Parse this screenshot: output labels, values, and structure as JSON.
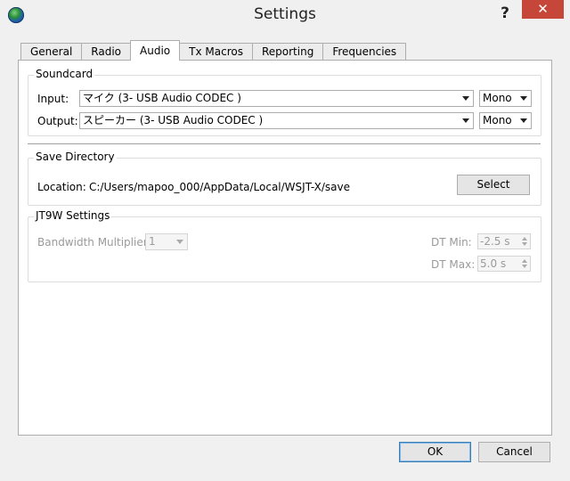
{
  "window": {
    "title": "Settings",
    "help_label": "?",
    "close_label": "✕"
  },
  "tabs": [
    {
      "label": "General"
    },
    {
      "label": "Radio"
    },
    {
      "label": "Audio"
    },
    {
      "label": "Tx Macros"
    },
    {
      "label": "Reporting"
    },
    {
      "label": "Frequencies"
    }
  ],
  "active_tab": "Audio",
  "soundcard": {
    "title": "Soundcard",
    "input_label": "Input:",
    "input_device": "マイク (3- USB Audio CODEC )",
    "input_channel": "Mono",
    "output_label": "Output:",
    "output_device": "スピーカー (3- USB Audio CODEC )",
    "output_channel": "Mono"
  },
  "save_directory": {
    "title": "Save Directory",
    "location_label": "Location:",
    "location_value": "C:/Users/mapoo_000/AppData/Local/WSJT-X/save",
    "select_label": "Select"
  },
  "jt9w": {
    "title": "JT9W Settings",
    "bandwidth_label": "Bandwidth Multiplier:",
    "bandwidth_value": "1",
    "dt_min_label": "DT Min:",
    "dt_min_value": "-2.5 s",
    "dt_max_label": "DT Max:",
    "dt_max_value": "5.0 s"
  },
  "footer": {
    "ok_label": "OK",
    "cancel_label": "Cancel"
  }
}
